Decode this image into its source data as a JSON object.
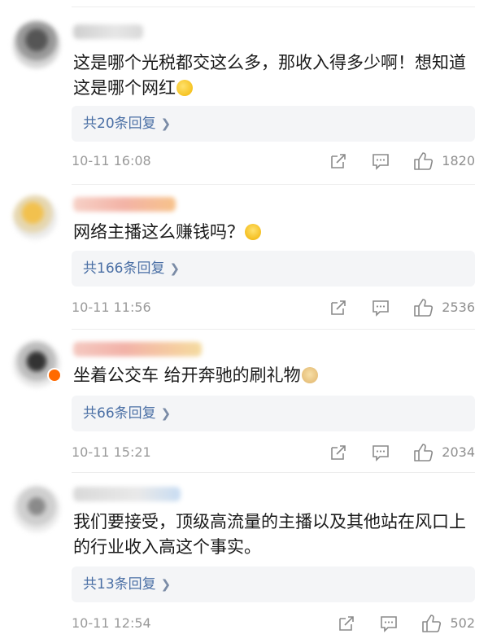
{
  "comments": [
    {
      "text": "这是哪个光税都交这么多，那收入得多少啊！想知道\n这是哪个网红",
      "replies_label": "共20条回复",
      "time": "10-11 16:08",
      "likes": "1820",
      "emoji": "grinning-sweat-emoji"
    },
    {
      "text": "网络主播这么赚钱吗？",
      "replies_label": "共166条回复",
      "time": "10-11 11:56",
      "likes": "2536",
      "emoji": "astonished-emoji"
    },
    {
      "text": "坐着公交车 给开奔驰的刷礼物",
      "replies_label": "共66条回复",
      "time": "10-11 15:21",
      "likes": "2034",
      "emoji": "doge-emoji"
    },
    {
      "text": "我们要接受，顶级高流量的主播以及其他站在风口上\n的行业收入高这个事实。",
      "replies_label": "共13条回复",
      "time": "10-11 12:54",
      "likes": "502",
      "emoji": ""
    }
  ],
  "icons": {
    "share": "share-icon",
    "comment": "comment-icon",
    "like": "thumbs-up-icon",
    "chevron": "chevron-right-icon"
  },
  "colors": {
    "reply_link": "#4a6fa5",
    "meta_text": "#9a9a9a",
    "reply_bg": "#f4f5f7"
  }
}
